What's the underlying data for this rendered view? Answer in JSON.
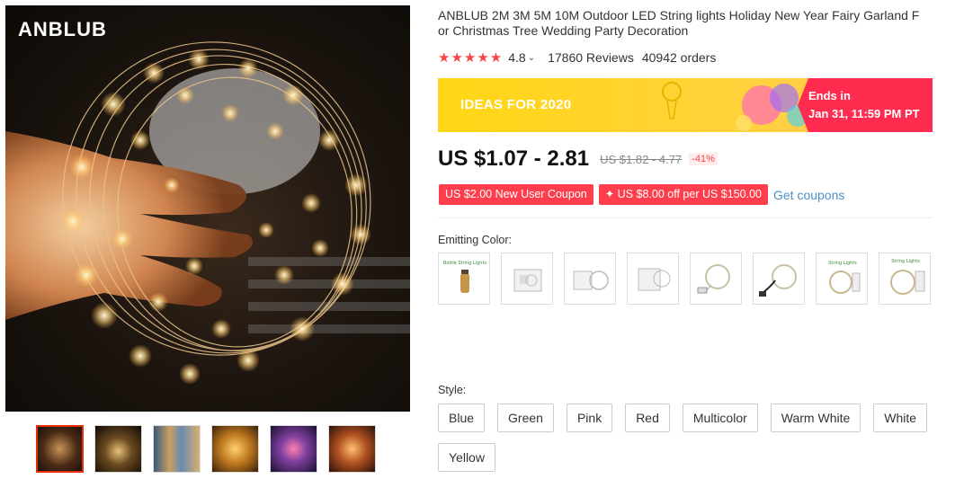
{
  "gallery": {
    "brand": "ANBLUB",
    "thumbnails": [
      "thumb-1",
      "thumb-2",
      "thumb-3",
      "thumb-4",
      "thumb-5",
      "thumb-6"
    ],
    "active_index": 0
  },
  "product": {
    "title_line1": "ANBLUB 2M 3M 5M 10M Outdoor LED String lights Holiday New Year Fairy Garland F",
    "title_line2": "or Christmas Tree Wedding Party Decoration",
    "rating": "4.8",
    "reviews": "17860 Reviews",
    "orders": "40942 orders",
    "stars": "★★★★★"
  },
  "banner": {
    "left_text": "IDEAS FOR 2020",
    "ends_label": "Ends in",
    "ends_time": "Jan 31, 11:59 PM PT"
  },
  "price": {
    "current": "US $1.07 - 2.81",
    "original": "US $1.82 - 4.77",
    "discount": "-41%"
  },
  "coupons": {
    "new_user": "US $2.00 New User Coupon",
    "store": "✦ US $8.00 off per US $150.00",
    "get_coupons": "Get coupons"
  },
  "options": {
    "color_label": "Emitting Color:",
    "style_label": "Style:",
    "styles": [
      "Blue",
      "Green",
      "Pink",
      "Red",
      "Multicolor",
      "Warm White",
      "White",
      "Yellow"
    ]
  },
  "colors": {
    "accent": "#ff3e4d",
    "banner_yellow": "#ffd615",
    "ends_red": "#ff2c4f",
    "link": "#4a90c8",
    "stars": "#f64644"
  }
}
